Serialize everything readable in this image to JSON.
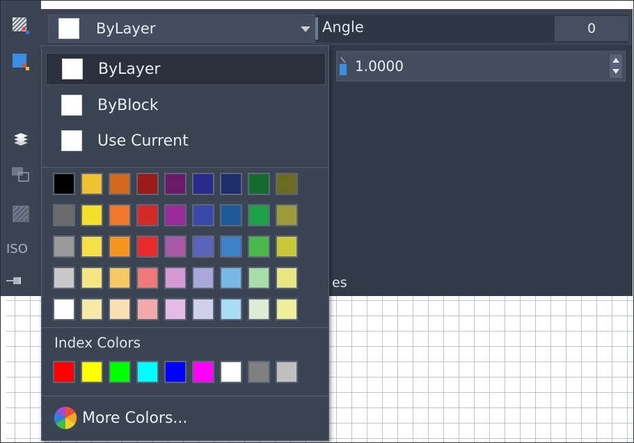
{
  "top_bar": {
    "selected_color": "ByLayer",
    "angle_label": "Angle",
    "angle_value": "0"
  },
  "scale": {
    "value": "1.0000"
  },
  "panel_fragment": "es",
  "left_strip": {
    "iso_label": "ISO"
  },
  "dropdown": {
    "options": [
      {
        "label": "ByLayer",
        "selected": true
      },
      {
        "label": "ByBlock",
        "selected": false
      },
      {
        "label": "Use Current",
        "selected": false
      }
    ],
    "palette_rows": [
      [
        "#000000",
        "#f1c232",
        "#d2691e",
        "#9b1b1b",
        "#6b1a6b",
        "#2a2a8c",
        "#1f2f6b",
        "#146b2e",
        "#6b6b24"
      ],
      [
        "#6b6b6b",
        "#f5e02a",
        "#f0782a",
        "#d42a2a",
        "#9b2a9b",
        "#3a4aa8",
        "#1f5a9b",
        "#1ea04a",
        "#9b9b3a"
      ],
      [
        "#9a9a9a",
        "#f5e04a",
        "#f5941e",
        "#e82a2a",
        "#a85aa8",
        "#5a64b8",
        "#3c82c8",
        "#4ab84a",
        "#c8c83a"
      ],
      [
        "#c8c8c8",
        "#f5e682",
        "#f5c864",
        "#f07878",
        "#d49ad4",
        "#a8a8dc",
        "#78b8e6",
        "#a8dca8",
        "#e6e682"
      ],
      [
        "#ffffff",
        "#f5eaa8",
        "#f8e0b4",
        "#f5aaaa",
        "#e6bce6",
        "#d0d0ec",
        "#a8dcf5",
        "#dcecd4",
        "#eeee9a"
      ]
    ],
    "index_colors_label": "Index Colors",
    "index_colors": [
      "#ff0000",
      "#ffff00",
      "#00ff00",
      "#00ffff",
      "#0000ff",
      "#ff00ff",
      "#ffffff",
      "#808080",
      "#c0c0c0"
    ],
    "more_colors_label": "More Colors..."
  }
}
